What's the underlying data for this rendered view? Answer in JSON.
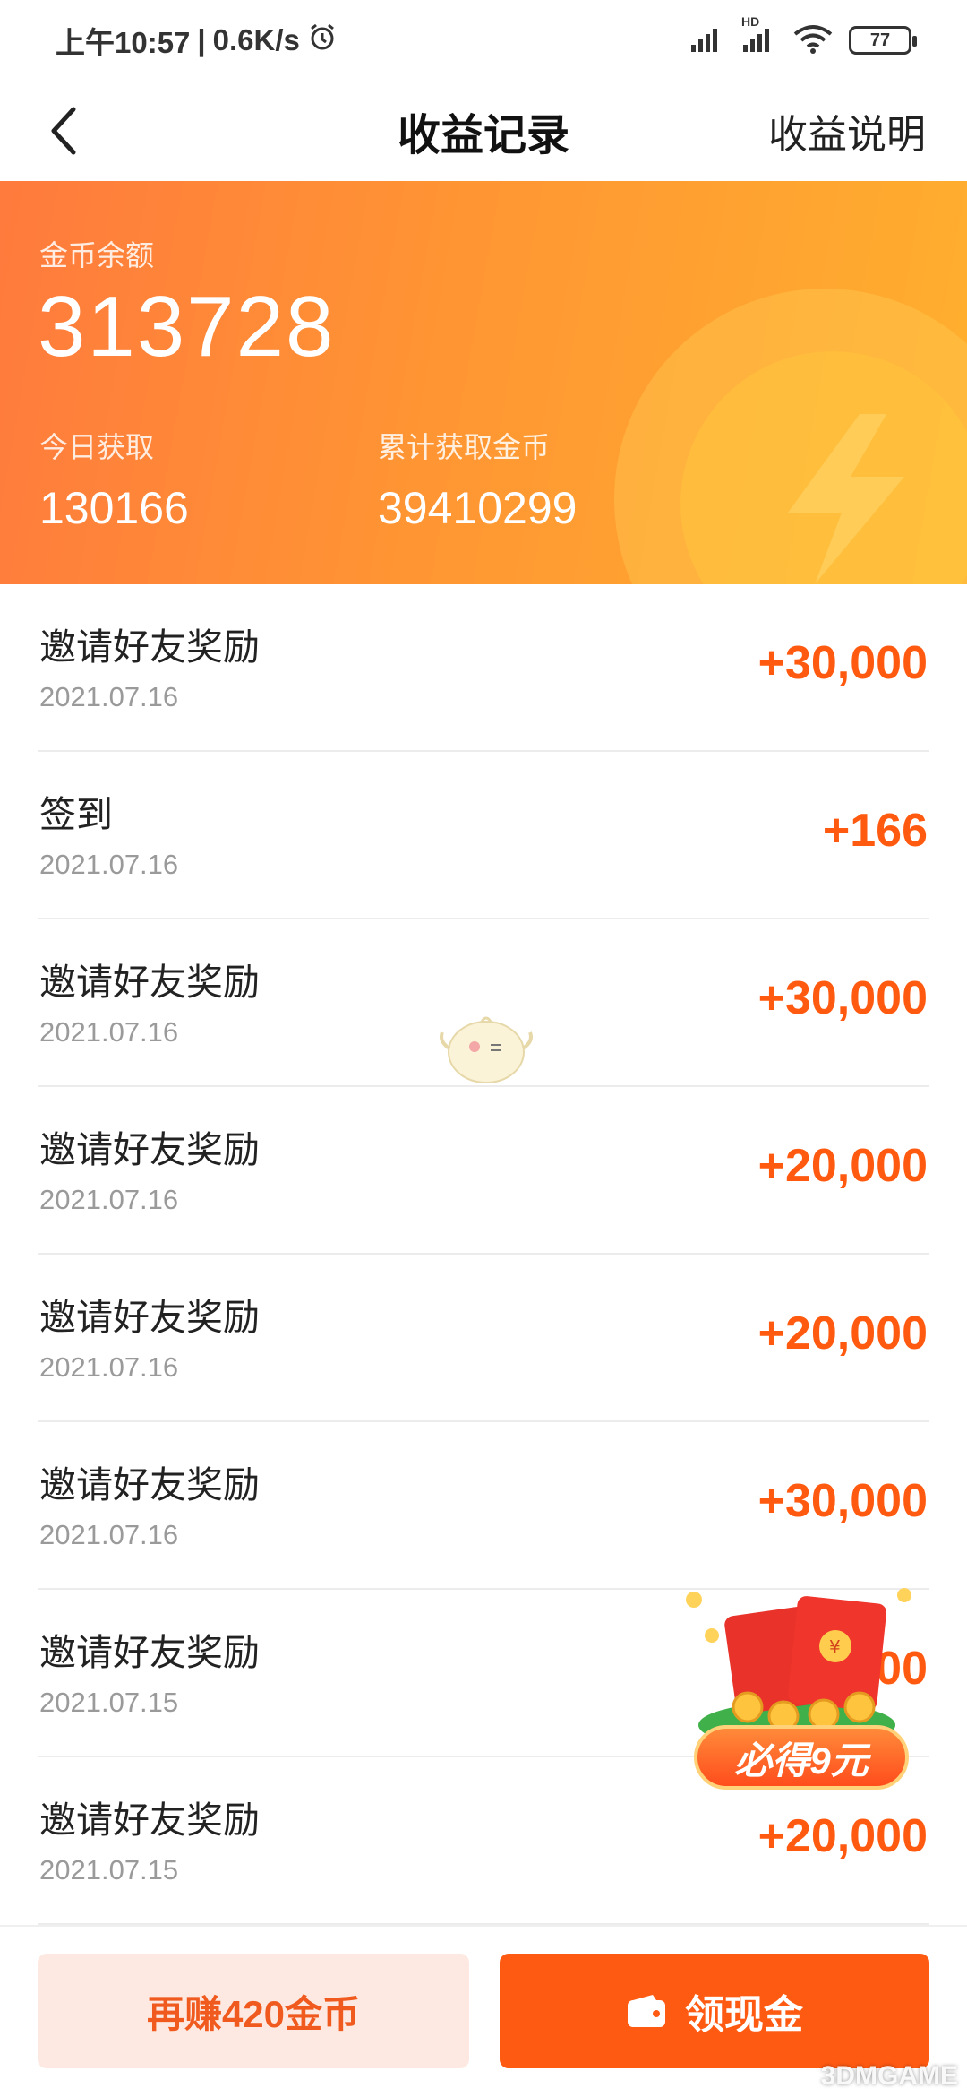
{
  "status_bar": {
    "time": "上午10:57",
    "separator": "|",
    "speed": "0.6K/s",
    "battery": "77",
    "hd_label": "HD"
  },
  "nav": {
    "title": "收益记录",
    "right_link": "收益说明"
  },
  "summary": {
    "balance_label": "金币余额",
    "balance_value": "313728",
    "today_label": "今日获取",
    "today_value": "130166",
    "total_label": "累计获取金币",
    "total_value": "39410299"
  },
  "records": [
    {
      "title": "邀请好友奖励",
      "date": "2021.07.16",
      "amount": "+30,000"
    },
    {
      "title": "签到",
      "date": "2021.07.16",
      "amount": "+166"
    },
    {
      "title": "邀请好友奖励",
      "date": "2021.07.16",
      "amount": "+30,000"
    },
    {
      "title": "邀请好友奖励",
      "date": "2021.07.16",
      "amount": "+20,000"
    },
    {
      "title": "邀请好友奖励",
      "date": "2021.07.16",
      "amount": "+20,000"
    },
    {
      "title": "邀请好友奖励",
      "date": "2021.07.16",
      "amount": "+30,000"
    },
    {
      "title": "邀请好友奖励",
      "date": "2021.07.15",
      "amount": "00"
    },
    {
      "title": "邀请好友奖励",
      "date": "2021.07.15",
      "amount": "+20,000"
    }
  ],
  "promo": {
    "badge": "必得9元",
    "currency_symbol": "¥"
  },
  "bottom": {
    "earn_button": "再赚420金币",
    "cash_button": "领现金"
  },
  "watermark": "3DMGAME",
  "colors": {
    "accent": "#ff5a12",
    "amount": "#ff5a10",
    "hero_start": "#ff7a3d",
    "hero_end": "#ffb02e"
  }
}
